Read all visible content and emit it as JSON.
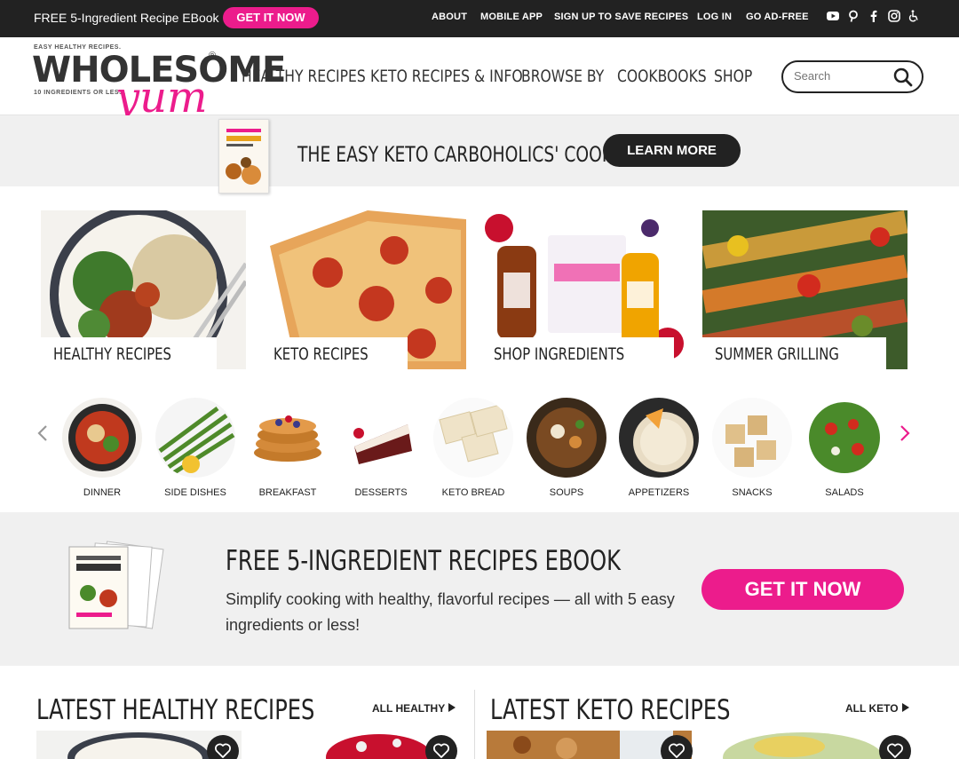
{
  "topbar": {
    "promo_text": "FREE 5-Ingredient Recipe EBook",
    "promo_button": "GET IT NOW",
    "links": [
      "ABOUT",
      "MOBILE APP",
      "SIGN UP TO SAVE RECIPES",
      "LOG IN",
      "GO AD-FREE"
    ],
    "social_icons": [
      "youtube-icon",
      "pinterest-icon",
      "facebook-icon",
      "instagram-icon",
      "accessibility-icon"
    ]
  },
  "logo": {
    "tagline_top": "EASY HEALTHY RECIPES.",
    "main": "WHOLESOME",
    "sub": "10 INGREDIENTS OR LESS.",
    "script": "yum",
    "reg": "®"
  },
  "nav": {
    "items": [
      "HEALTHY RECIPES",
      "KETO RECIPES & INFO",
      "BROWSE BY",
      "COOKBOOKS",
      "SHOP"
    ]
  },
  "search": {
    "placeholder": "Search"
  },
  "cookbook_banner": {
    "title": "THE EASY KETO CARBOHOLICS' COOKBOOK",
    "button": "LEARN MORE"
  },
  "tiles": [
    {
      "label": "HEALTHY RECIPES"
    },
    {
      "label": "KETO RECIPES"
    },
    {
      "label": "SHOP INGREDIENTS"
    },
    {
      "label": "SUMMER GRILLING"
    }
  ],
  "categories": [
    "DINNER",
    "SIDE DISHES",
    "BREAKFAST",
    "DESSERTS",
    "KETO BREAD",
    "SOUPS",
    "APPETIZERS",
    "SNACKS",
    "SALADS"
  ],
  "ebook": {
    "title": "FREE 5-INGREDIENT RECIPES EBOOK",
    "description": "Simplify cooking with healthy, flavorful recipes — all with 5 easy ingredients or less!",
    "button": "GET IT NOW"
  },
  "latest": {
    "healthy_title": "LATEST HEALTHY RECIPES",
    "healthy_link": "ALL HEALTHY",
    "keto_title": "LATEST KETO RECIPES",
    "keto_link": "ALL KETO"
  },
  "colors": {
    "accent": "#ec1c8c",
    "dark": "#222222",
    "band": "#f0f0f0"
  }
}
